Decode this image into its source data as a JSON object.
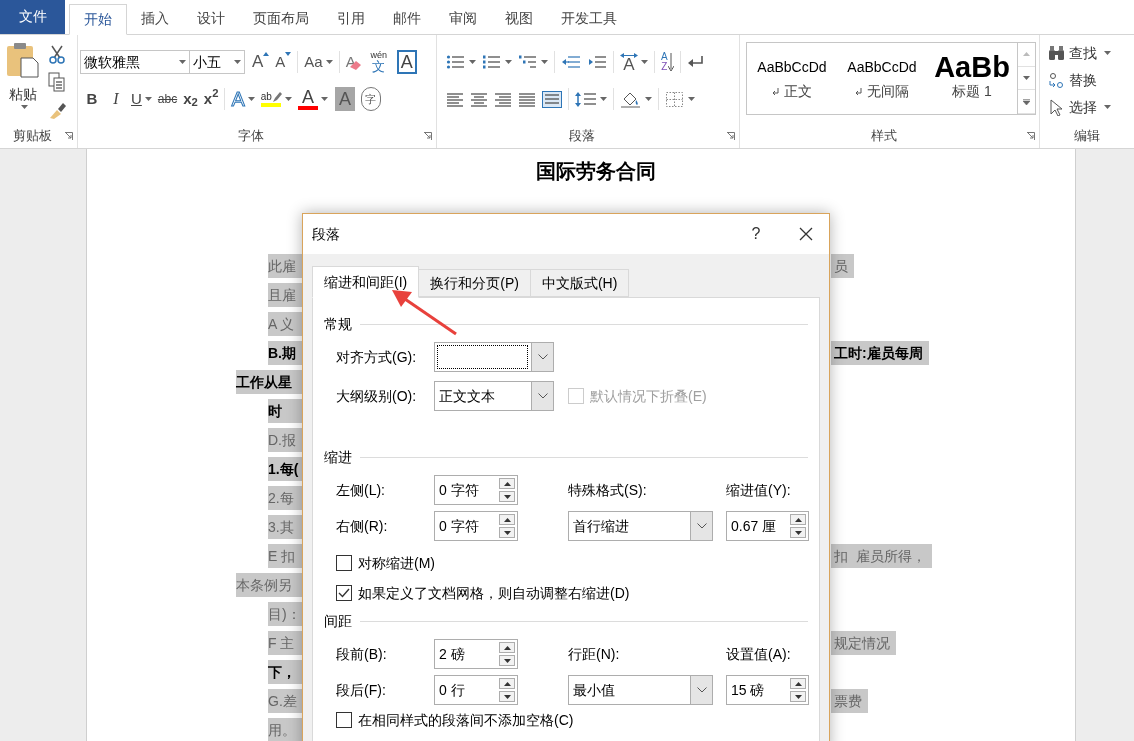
{
  "file_tab": "文件",
  "tabs": [
    {
      "label": "开始",
      "selected": true
    },
    {
      "label": "插入",
      "selected": false
    },
    {
      "label": "设计",
      "selected": false
    },
    {
      "label": "页面布局",
      "selected": false
    },
    {
      "label": "引用",
      "selected": false
    },
    {
      "label": "邮件",
      "selected": false
    },
    {
      "label": "审阅",
      "selected": false
    },
    {
      "label": "视图",
      "selected": false
    },
    {
      "label": "开发工具",
      "selected": false
    }
  ],
  "clipboard": {
    "label": "剪贴板",
    "paste": "粘贴"
  },
  "font": {
    "label": "字体",
    "font_name": "微软雅黑",
    "font_size": "小五",
    "row1": [
      [
        {
          "kind": "grow",
          "text": "A"
        },
        {
          "kind": "shrink",
          "text": "A"
        }
      ],
      [
        {
          "kind": "case",
          "text": "Aa"
        }
      ],
      [
        {
          "kind": "clear",
          "text": "A"
        },
        {
          "kind": "phonetic",
          "text": "wén",
          "text2": "文"
        },
        {
          "kind": "border",
          "text": "A"
        }
      ]
    ],
    "row2": [
      [
        {
          "kind": "bold",
          "text": "B"
        },
        {
          "kind": "italic",
          "text": "I"
        },
        {
          "kind": "underline",
          "text": "U"
        },
        {
          "kind": "strike",
          "text": "abc"
        },
        {
          "kind": "subscript",
          "text": "x$_{2}$"
        },
        {
          "kind": "superscript",
          "text": "x$^{2}$"
        }
      ],
      [
        {
          "kind": "effects",
          "text": "A"
        },
        {
          "kind": "highlight",
          "text": "ab",
          "color": "#ffff00"
        },
        {
          "kind": "color",
          "text": "A",
          "color": "#ff0000"
        },
        {
          "kind": "shading",
          "text": "A"
        },
        {
          "kind": "enclose",
          "text": "字"
        }
      ]
    ]
  },
  "paragraph": {
    "label": "段落",
    "row1": [
      [
        {
          "kind": "bullets"
        },
        {
          "kind": "numbering"
        },
        {
          "kind": "multilevel"
        }
      ],
      [
        {
          "kind": "outdent"
        },
        {
          "kind": "indent"
        }
      ],
      [
        {
          "kind": "direction",
          "text": "A"
        }
      ],
      [
        {
          "kind": "sort",
          "text": "A",
          "text2": "Z"
        }
      ],
      [
        {
          "kind": "marks"
        }
      ]
    ],
    "row2": [
      [
        {
          "kind": "left"
        },
        {
          "kind": "center"
        },
        {
          "kind": "right"
        },
        {
          "kind": "justify"
        },
        {
          "kind": "distributed"
        }
      ],
      [
        {
          "kind": "spacing"
        }
      ],
      [
        {
          "kind": "shading"
        }
      ],
      [
        {
          "kind": "borders"
        }
      ]
    ]
  },
  "styles": {
    "label": "样式",
    "items": [
      {
        "kind": "body",
        "preview": "AaBbCcDd",
        "name": "正文"
      },
      {
        "kind": "body",
        "preview": "AaBbCcDd",
        "name": "无间隔"
      },
      {
        "kind": "heading",
        "preview": "AaBb",
        "name": "标题 1"
      }
    ]
  },
  "editing": {
    "label": "编辑",
    "items": [
      {
        "kind": "find",
        "label": "查找"
      },
      {
        "kind": "replace",
        "label": "替换"
      },
      {
        "kind": "select",
        "label": "选择"
      }
    ]
  },
  "document": {
    "title": "国际劳务合同",
    "lines": [
      {
        "kind": "para",
        "left": "此雇",
        "right": "员",
        "bold": false
      },
      {
        "kind": "para",
        "left": "且雇",
        "bold": false
      },
      {
        "kind": "para",
        "left": "A 义",
        "bold": false
      },
      {
        "kind": "para",
        "left": "B.期",
        "right": "工时:雇员每周",
        "bold": true
      },
      {
        "kind": "wrap",
        "left": "工作从星",
        "bold": true
      },
      {
        "kind": "para",
        "left": "时",
        "bold": true
      },
      {
        "kind": "para",
        "left": "D.报",
        "bold": false
      },
      {
        "kind": "para",
        "left": "1.每(",
        "bold": true
      },
      {
        "kind": "para",
        "left": "2.每",
        "bold": false
      },
      {
        "kind": "para",
        "left": "3.其",
        "bold": false
      },
      {
        "kind": "para",
        "left": "E 扣",
        "right": "扣  雇员所得，",
        "bold": false
      },
      {
        "kind": "wrap",
        "left": "本条例另",
        "bold": false
      },
      {
        "kind": "para",
        "left": "目)：",
        "bold": false
      },
      {
        "kind": "para",
        "left": "F 主",
        "right": "规定情况",
        "bold": false
      },
      {
        "kind": "para",
        "left": "下，",
        "bold": true
      },
      {
        "kind": "para",
        "left": "G.差",
        "right": "票费",
        "bold": false
      },
      {
        "kind": "para",
        "left": "用。",
        "bold": false
      }
    ]
  },
  "dialog": {
    "title": "段落",
    "help": "?",
    "tabs": [
      {
        "label": "缩进和间距(I)",
        "selected": true
      },
      {
        "label": "换行和分页(P)",
        "selected": false
      },
      {
        "label": "中文版式(H)",
        "selected": false
      }
    ],
    "general": {
      "title": "常规",
      "fields": [
        {
          "label": "对齐方式(G):",
          "focused": true
        },
        {
          "label": "大纲级别(O):",
          "value": "正文文本",
          "focused": false,
          "checkbox": {
            "label": "默认情况下折叠(E)",
            "checked": false,
            "disabled": true
          }
        }
      ]
    },
    "sections": [
      {
        "title": "缩进",
        "rows": [
          [
            {
              "kind": "spin",
              "label": "左侧(L):",
              "value": "0 字符"
            },
            {
              "kind": "label",
              "label": "特殊格式(S):"
            },
            {
              "kind": "label",
              "label": "缩进值(Y):"
            }
          ],
          [
            {
              "kind": "spin",
              "label": "右侧(R):",
              "value": "0 字符"
            },
            {
              "kind": "dropdown",
              "value": "首行缩进"
            },
            {
              "kind": "spin",
              "value": "0.67 厘"
            }
          ]
        ],
        "checkboxes": [
          {
            "label": "对称缩进(M)",
            "checked": false
          },
          {
            "label": "如果定义了文档网格，则自动调整右缩进(D)",
            "checked": true
          }
        ]
      },
      {
        "title": "间距",
        "rows": [
          [
            {
              "kind": "spin",
              "label": "段前(B):",
              "value": "2 磅"
            },
            {
              "kind": "label",
              "label": "行距(N):"
            },
            {
              "kind": "label",
              "label": "设置值(A):"
            }
          ],
          [
            {
              "kind": "spin",
              "label": "段后(F):",
              "value": "0 行"
            },
            {
              "kind": "dropdown",
              "value": "最小值"
            },
            {
              "kind": "spin",
              "value": "15 磅"
            }
          ]
        ],
        "checkboxes": [
          {
            "label": "在相同样式的段落间不添加空格(C)",
            "checked": false
          }
        ]
      }
    ]
  }
}
